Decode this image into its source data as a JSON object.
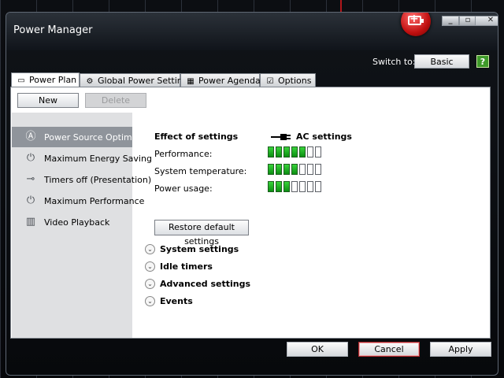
{
  "window": {
    "title": "Power Manager"
  },
  "header": {
    "switch_label": "Switch to:",
    "switch_button": "Basic",
    "help_glyph": "?"
  },
  "tabs": [
    {
      "label": "Power Plan",
      "icon": "document-icon",
      "active": true
    },
    {
      "label": "Global Power Settings",
      "icon": "gear-icon"
    },
    {
      "label": "Power Agendas",
      "icon": "calendar-icon"
    },
    {
      "label": "Options",
      "icon": "checkbox-icon"
    }
  ],
  "toolbar": {
    "new_label": "New",
    "delete_label": "Delete"
  },
  "plans": [
    {
      "label": "Power Source Optimized",
      "icon": "auto-icon",
      "selected": true
    },
    {
      "label": "Maximum Energy Saving",
      "icon": "power-icon"
    },
    {
      "label": "Timers off (Presentation)",
      "icon": "projector-icon"
    },
    {
      "label": "Maximum Performance",
      "icon": "power-icon"
    },
    {
      "label": "Video Playback",
      "icon": "film-icon"
    }
  ],
  "effects": {
    "heading": "Effect of settings",
    "ac_label": "AC settings",
    "rows": [
      {
        "label": "Performance:",
        "level": 5,
        "max": 7
      },
      {
        "label": "System temperature:",
        "level": 4,
        "max": 7
      },
      {
        "label": "Power usage:",
        "level": 3,
        "max": 7
      }
    ],
    "restore_label": "Restore default settings"
  },
  "sections": [
    "System settings",
    "Idle timers",
    "Advanced settings",
    "Events"
  ],
  "footer": {
    "ok": "OK",
    "cancel": "Cancel",
    "apply": "Apply"
  },
  "colors": {
    "meter_on": "#1fb526",
    "selected_item": "#8f949b",
    "battery_badge": "#c01010"
  }
}
